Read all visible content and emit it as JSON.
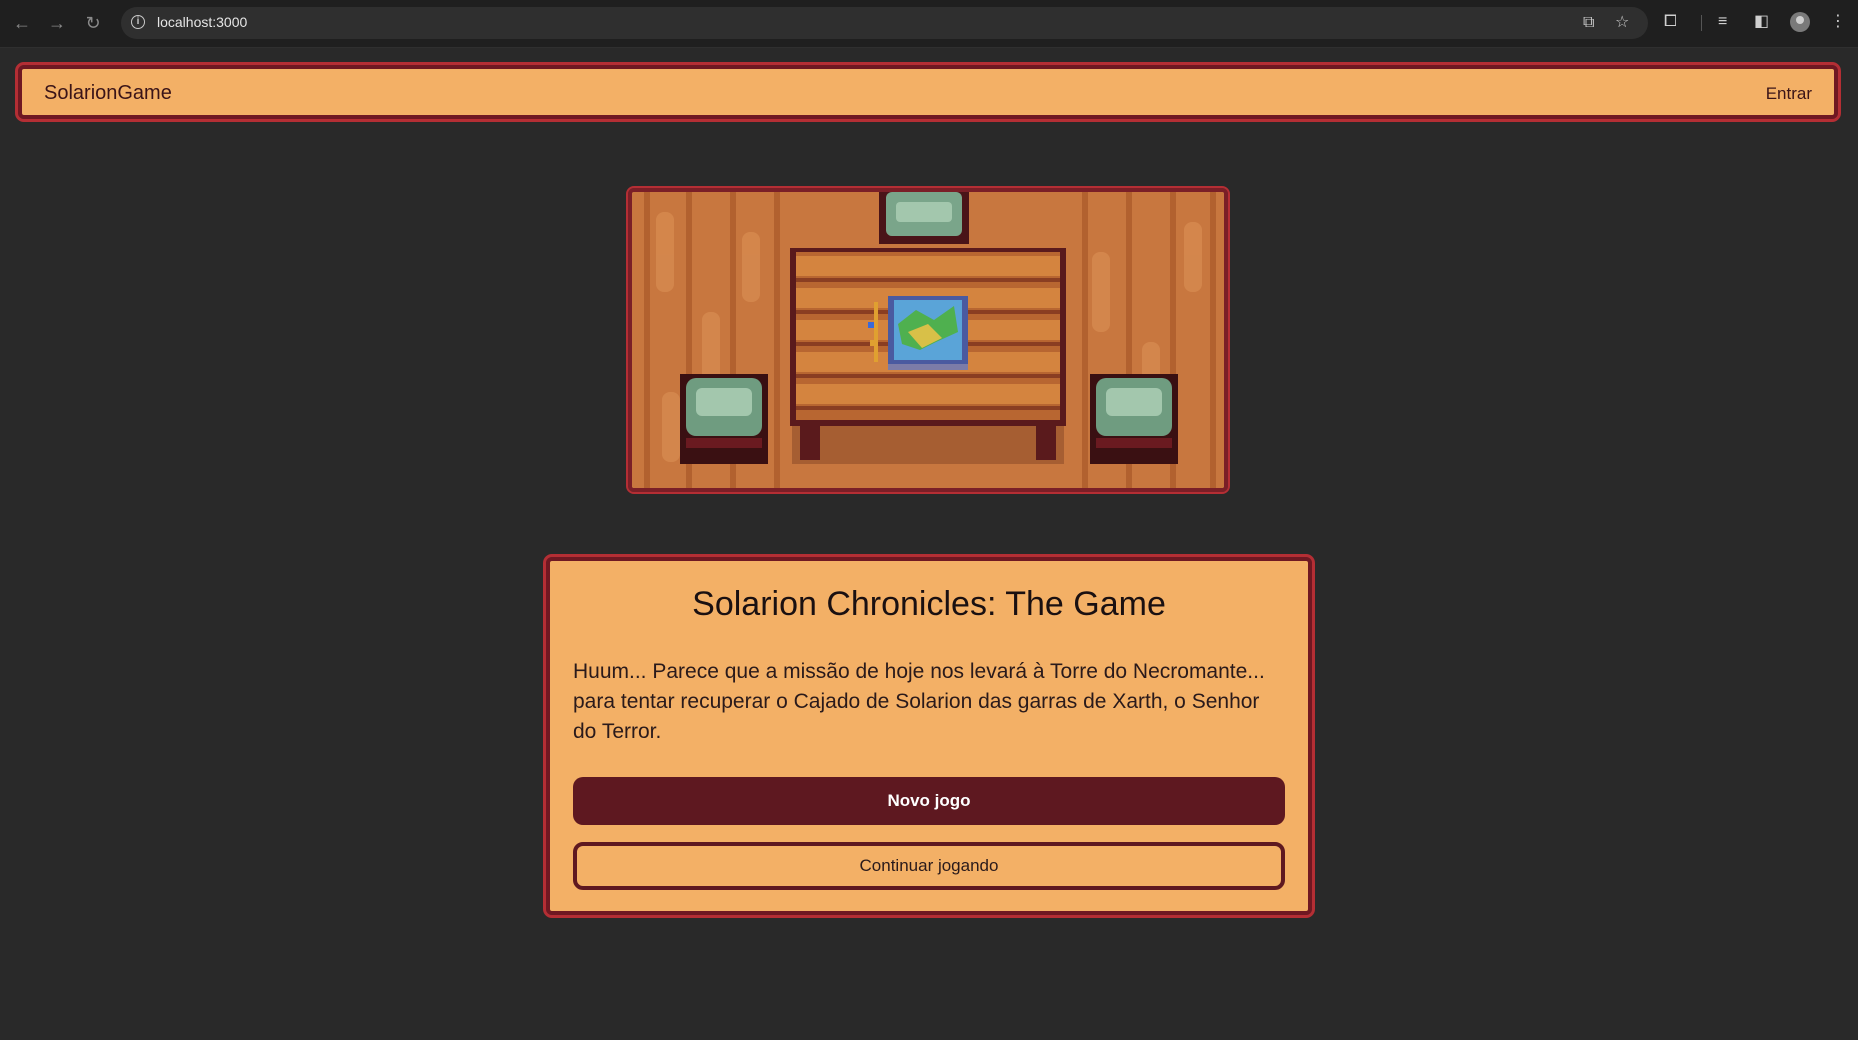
{
  "browser": {
    "url": "localhost:3000",
    "icons": [
      "back-icon",
      "forward-icon",
      "reload-icon",
      "site-info-icon",
      "install-app-icon",
      "bookmark-star-icon",
      "extensions-icon",
      "media-controls-icon",
      "side-panel-icon",
      "profile-avatar",
      "menu-kebab-icon"
    ]
  },
  "navbar": {
    "brand": "SolarionGame",
    "login_label": "Entrar"
  },
  "colors": {
    "page_bg": "#292929",
    "panel": "#f3b066",
    "border_dark": "#6f1822",
    "border_light": "#b42e34",
    "button_primary": "#5e1820"
  },
  "card": {
    "title": "Solarion Chronicles: The Game",
    "description": "Huum... Parece que a missão de hoje nos levará à Torre do Necromante... para tentar recuperar o Cajado de Solarion das garras de Xarth, o Senhor do Terror.",
    "primary_button": "Novo jogo",
    "secondary_button": "Continuar jogando"
  }
}
